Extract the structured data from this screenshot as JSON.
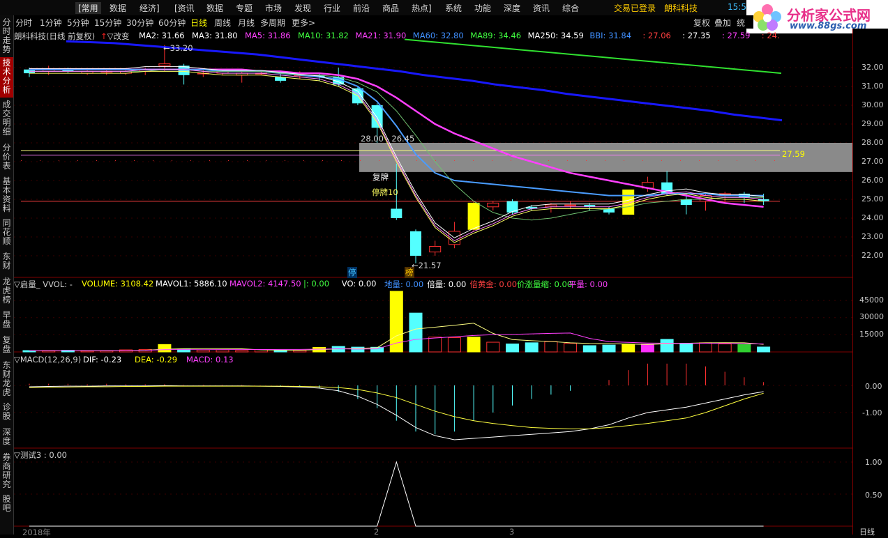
{
  "menu": {
    "items": [
      "[常用",
      "数据",
      "经济]",
      "[资讯",
      "数据",
      "专题",
      "市场",
      "发现",
      "行业",
      "前沿",
      "商品",
      "热点]",
      "系统",
      "功能",
      "深度",
      "资讯",
      "综合"
    ],
    "login_status": "交易已登录",
    "stock_name": "朗科科技",
    "time": "15:5"
  },
  "logo": {
    "title": "分析家公式网",
    "url": "www.88gs.com"
  },
  "periods": [
    "分时",
    "1分钟",
    "5分钟",
    "15分钟",
    "30分钟",
    "60分钟",
    "日线",
    "周线",
    "月线",
    "多周期",
    "更多>"
  ],
  "selected_period": "日线",
  "right_tools": [
    "复权",
    "叠加",
    "统"
  ],
  "sidebar": {
    "tabs": [
      "分时走势",
      "技术分析",
      "成交明细",
      "分价表",
      "基本资料",
      "同花顺",
      "东财",
      "龙虎榜",
      "早盘",
      "复盘",
      "东财龙虎",
      "诊股",
      "深度",
      "券商研究",
      "股吧"
    ],
    "active": "技术分析"
  },
  "main_info": {
    "title": "朗科科技(日线 前复权)",
    "change_label": "改变",
    "indicators": [
      {
        "label": "MA2: 31.66",
        "color": "#ffffff"
      },
      {
        "label": "MA3: 31.80",
        "color": "#ffffff"
      },
      {
        "label": "MA5: 31.86",
        "color": "#ff40ff"
      },
      {
        "label": "MA10: 31.82",
        "color": "#40ff40"
      },
      {
        "label": "MA21: 31.90",
        "color": "#ff40ff"
      },
      {
        "label": "MA60: 32.80",
        "color": "#4090ff"
      },
      {
        "label": "MA89: 34.46",
        "color": "#40ff40"
      },
      {
        "label": "MA250: 34.59",
        "color": "#ffffff"
      },
      {
        "label": "BBI: 31.84",
        "color": "#4090ff"
      },
      {
        "label": ": 27.06",
        "color": "#ff4040"
      },
      {
        "label": ": 27.35",
        "color": "#ffffff"
      },
      {
        "label": ": 27.59",
        "color": "#ff40ff"
      },
      {
        "label": ": 24.",
        "color": "#ff4040"
      }
    ]
  },
  "price_axis": [
    "32.00",
    "31.00",
    "30.00",
    "29.00",
    "28.00",
    "27.00",
    "26.00",
    "25.00",
    "24.00",
    "23.00",
    "22.00"
  ],
  "annotations": {
    "high": "33.20",
    "low": "21.57",
    "range": "28.00 - 26.45",
    "resume": "复牌",
    "halt": "停牌10",
    "level": "27.59",
    "tag_halt": "停",
    "tag_list": "榜"
  },
  "vol_info": {
    "title": "启量_ VVOL: -",
    "items": [
      {
        "label": "VOLUME: 3108.42",
        "color": "#ffff00"
      },
      {
        "label": "MAVOL1: 5886.10",
        "color": "#ffffff"
      },
      {
        "label": "MAVOL2: 4147.50",
        "color": "#ff40ff"
      },
      {
        "label": "|: 0.00",
        "color": "#40ff40"
      },
      {
        "label": "VO: 0.00",
        "color": "#ffffff"
      },
      {
        "label": "地量: 0.00",
        "color": "#4090ff"
      },
      {
        "label": "倍量: 0.00",
        "color": "#ffffff"
      },
      {
        "label": "倍黄金: 0.00",
        "color": "#ff4040"
      },
      {
        "label": "价涨量缩: 0.00",
        "color": "#40ff40"
      },
      {
        "label": "平量: 0.00",
        "color": "#ff40ff"
      }
    ],
    "axis": [
      "45000",
      "30000",
      "15000"
    ]
  },
  "macd_info": {
    "title": "MACD(12,26,9)",
    "items": [
      {
        "label": "DIF: -0.23",
        "color": "#ffffff"
      },
      {
        "label": "DEA: -0.29",
        "color": "#ffff00"
      },
      {
        "label": "MACD: 0.13",
        "color": "#ff40ff"
      }
    ],
    "axis": [
      "0.00",
      "-1.00"
    ]
  },
  "test_info": {
    "title": "测试3 : 0.00",
    "axis": [
      "1.00",
      "0.50"
    ]
  },
  "date_axis": [
    "2018年",
    "2",
    "3",
    "日线"
  ],
  "chart_data": {
    "type": "candlestick",
    "price_ylim": [
      21.4,
      33.5
    ],
    "candles": [
      {
        "o": 31.9,
        "c": 31.7,
        "h": 32.0,
        "l": 31.5
      },
      {
        "o": 31.8,
        "c": 31.9,
        "h": 32.1,
        "l": 31.6
      },
      {
        "o": 31.9,
        "c": 31.8,
        "h": 32.0,
        "l": 31.7
      },
      {
        "o": 31.7,
        "c": 31.8,
        "h": 31.9,
        "l": 31.6
      },
      {
        "o": 31.8,
        "c": 31.8,
        "h": 31.9,
        "l": 31.6
      },
      {
        "o": 31.7,
        "c": 31.8,
        "h": 31.9,
        "l": 31.6
      },
      {
        "o": 31.8,
        "c": 31.9,
        "h": 32.0,
        "l": 31.6
      },
      {
        "o": 32.1,
        "c": 32.2,
        "h": 33.2,
        "l": 31.8
      },
      {
        "o": 32.1,
        "c": 31.6,
        "h": 32.2,
        "l": 31.1
      },
      {
        "o": 31.7,
        "c": 31.7,
        "h": 31.9,
        "l": 31.5
      },
      {
        "o": 31.7,
        "c": 31.8,
        "h": 31.9,
        "l": 31.6
      },
      {
        "o": 31.6,
        "c": 31.7,
        "h": 31.8,
        "l": 31.2
      },
      {
        "o": 31.7,
        "c": 31.7,
        "h": 31.8,
        "l": 31.6
      },
      {
        "o": 31.5,
        "c": 31.3,
        "h": 31.7,
        "l": 31.2
      },
      {
        "o": 31.6,
        "c": 31.6,
        "h": 31.8,
        "l": 31.4
      },
      {
        "o": 31.6,
        "c": 31.5,
        "h": 31.7,
        "l": 31.3
      },
      {
        "o": 31.5,
        "c": 31.1,
        "h": 32.0,
        "l": 31.0
      },
      {
        "o": 30.9,
        "c": 30.1,
        "h": 31.0,
        "l": 30.0
      },
      {
        "o": 30.0,
        "c": 28.8,
        "h": 30.1,
        "l": 28.0
      },
      {
        "o": 24.5,
        "c": 24.0,
        "h": 26.9,
        "l": 23.9
      },
      {
        "o": 23.3,
        "c": 22.0,
        "h": 23.4,
        "l": 21.6
      },
      {
        "o": 22.2,
        "c": 22.5,
        "h": 22.8,
        "l": 22.0
      },
      {
        "o": 22.6,
        "c": 23.3,
        "h": 23.8,
        "l": 22.4
      },
      {
        "o": 23.4,
        "c": 24.8,
        "h": 24.9,
        "l": 23.3
      },
      {
        "o": 24.6,
        "c": 24.8,
        "h": 24.9,
        "l": 24.4
      },
      {
        "o": 24.9,
        "c": 24.3,
        "h": 25.0,
        "l": 24.2
      },
      {
        "o": 24.6,
        "c": 24.5,
        "h": 24.7,
        "l": 24.4
      },
      {
        "o": 24.6,
        "c": 24.7,
        "h": 24.8,
        "l": 24.3
      },
      {
        "o": 24.7,
        "c": 24.7,
        "h": 24.9,
        "l": 24.5
      },
      {
        "o": 24.7,
        "c": 24.6,
        "h": 24.8,
        "l": 24.4
      },
      {
        "o": 24.5,
        "c": 24.3,
        "h": 24.6,
        "l": 24.2
      },
      {
        "o": 24.2,
        "c": 25.5,
        "h": 25.5,
        "l": 24.2
      },
      {
        "o": 25.6,
        "c": 25.9,
        "h": 26.2,
        "l": 25.4
      },
      {
        "o": 25.9,
        "c": 25.3,
        "h": 26.5,
        "l": 25.2
      },
      {
        "o": 25.0,
        "c": 24.7,
        "h": 25.3,
        "l": 24.2
      },
      {
        "o": 24.9,
        "c": 25.2,
        "h": 25.3,
        "l": 24.4
      },
      {
        "o": 25.2,
        "c": 25.3,
        "h": 25.4,
        "l": 24.8
      },
      {
        "o": 25.3,
        "c": 25.1,
        "h": 25.4,
        "l": 24.8
      },
      {
        "o": 25.0,
        "c": 24.9,
        "h": 25.3,
        "l": 24.7
      }
    ],
    "ma5": [
      31.8,
      31.8,
      31.8,
      31.8,
      31.8,
      31.8,
      31.9,
      31.9,
      31.9,
      31.8,
      31.7,
      31.7,
      31.7,
      31.6,
      31.5,
      31.4,
      31.1,
      30.6,
      29.2,
      27.1,
      25.2,
      23.6,
      22.8,
      23.3,
      23.7,
      24.2,
      24.5,
      24.6,
      24.6,
      24.6,
      24.6,
      24.8,
      25.1,
      25.3,
      25.4,
      25.2,
      25.1,
      25.1,
      25.0
    ],
    "ma10": [
      31.8,
      31.8,
      31.8,
      31.8,
      31.8,
      31.8,
      31.8,
      31.9,
      31.9,
      31.8,
      31.8,
      31.8,
      31.8,
      31.7,
      31.6,
      31.6,
      31.5,
      31.2,
      30.7,
      29.7,
      28.4,
      27.0,
      25.8,
      24.9,
      24.3,
      24.0,
      23.9,
      24.0,
      24.2,
      24.4,
      24.5,
      24.6,
      24.8,
      24.9,
      25.0,
      25.0,
      25.1,
      25.1,
      25.1
    ],
    "ma21": [
      31.9,
      31.9,
      31.9,
      31.9,
      31.9,
      31.9,
      31.9,
      31.9,
      31.9,
      31.9,
      31.9,
      31.9,
      31.8,
      31.8,
      31.7,
      31.7,
      31.6,
      31.4,
      31.0,
      30.4,
      29.7,
      29.0,
      28.5,
      28.1,
      27.7,
      27.3,
      27.0,
      26.7,
      26.4,
      26.2,
      26.0,
      25.8,
      25.6,
      25.4,
      25.2,
      25.0,
      24.8,
      24.7,
      24.6
    ],
    "bbi": [
      31.9,
      31.9,
      31.9,
      31.9,
      31.9,
      31.9,
      31.9,
      31.9,
      31.9,
      31.9,
      31.8,
      31.8,
      31.8,
      31.7,
      31.6,
      31.5,
      31.4,
      31.0,
      30.2,
      28.9,
      27.4,
      26.4,
      26.0,
      25.9,
      25.8,
      25.7,
      25.6,
      25.5,
      25.4,
      25.3,
      25.2,
      25.2,
      25.2,
      25.3,
      25.3,
      25.3,
      25.2,
      25.2,
      25.2
    ],
    "ma60": [
      33.4,
      33.35,
      33.3,
      33.2,
      33.1,
      33.0,
      32.9,
      32.8,
      32.7,
      32.55,
      32.4,
      32.25,
      32.1,
      31.95,
      31.8,
      31.6,
      31.45,
      31.3,
      31.1,
      30.95,
      30.8,
      30.6,
      30.45,
      30.3,
      30.15,
      30.0,
      29.85,
      29.7,
      29.5,
      29.35,
      29.2
    ],
    "ma89": [
      33.5,
      33.4,
      33.3,
      33.2,
      33.1,
      33.0,
      32.9,
      32.8,
      32.7,
      32.6,
      32.5,
      32.4,
      32.3,
      32.2,
      32.1,
      32.0,
      31.9,
      31.8,
      31.7
    ],
    "volume": [
      1200,
      900,
      1500,
      800,
      1000,
      1800,
      2200,
      6500,
      2500,
      1600,
      1800,
      1200,
      2000,
      1400,
      1300,
      4000,
      4800,
      4200,
      4100,
      53000,
      34000,
      13000,
      12500,
      13000,
      8500,
      7000,
      8000,
      9000,
      7500,
      5500,
      6000,
      6500,
      6800,
      11000,
      7500,
      8000,
      7000,
      6500,
      4300
    ],
    "macd_dif": [
      -0.05,
      -0.04,
      -0.03,
      -0.03,
      -0.02,
      -0.02,
      -0.02,
      -0.01,
      -0.02,
      -0.02,
      -0.02,
      -0.02,
      -0.03,
      -0.04,
      -0.06,
      -0.1,
      -0.2,
      -0.4,
      -0.7,
      -1.1,
      -1.55,
      -1.85,
      -2.0,
      -1.95,
      -1.9,
      -1.85,
      -1.8,
      -1.75,
      -1.7,
      -1.6,
      -1.45,
      -1.2,
      -1.0,
      -0.9,
      -0.8,
      -0.65,
      -0.5,
      -0.35,
      -0.23
    ],
    "macd_dea": [
      -0.08,
      -0.07,
      -0.06,
      -0.05,
      -0.05,
      -0.04,
      -0.04,
      -0.03,
      -0.03,
      -0.03,
      -0.03,
      -0.03,
      -0.03,
      -0.03,
      -0.04,
      -0.05,
      -0.08,
      -0.15,
      -0.28,
      -0.45,
      -0.7,
      -0.95,
      -1.15,
      -1.3,
      -1.4,
      -1.48,
      -1.55,
      -1.58,
      -1.6,
      -1.6,
      -1.55,
      -1.48,
      -1.4,
      -1.3,
      -1.2,
      -1.0,
      -0.75,
      -0.5,
      -0.29
    ],
    "test3": [
      0,
      0,
      0,
      0,
      0,
      0,
      0,
      0,
      0,
      0,
      0,
      0,
      0,
      0,
      0,
      0,
      0,
      0,
      0,
      1,
      0,
      0,
      0,
      0,
      0,
      0,
      0,
      0,
      0,
      0,
      0,
      0,
      0,
      0,
      0,
      0,
      0,
      0,
      0
    ]
  }
}
